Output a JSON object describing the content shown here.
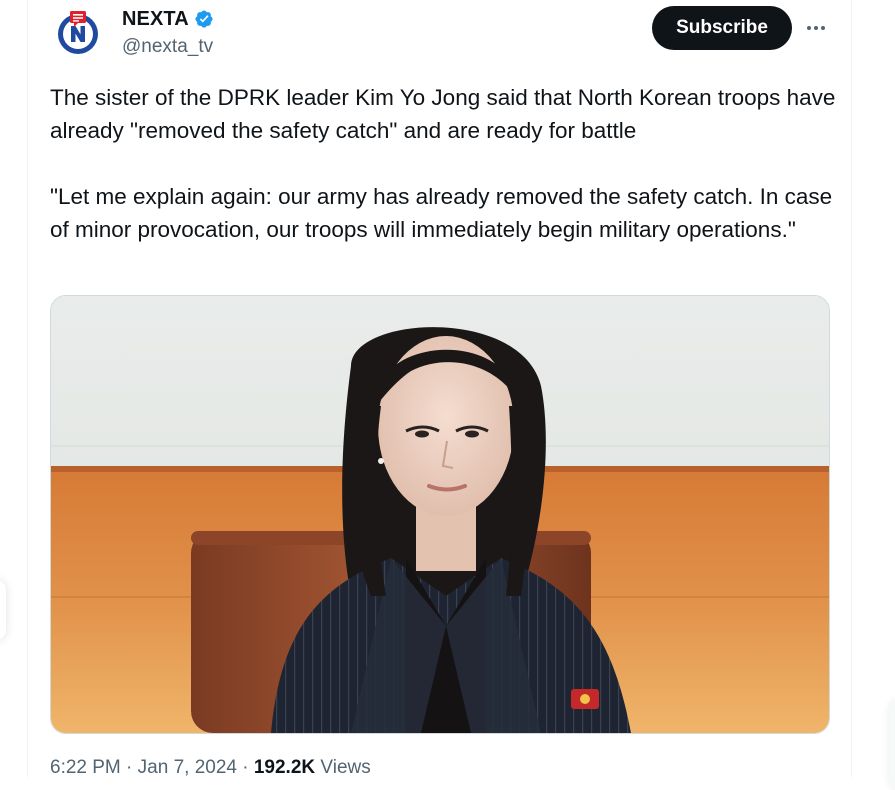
{
  "author": {
    "display_name": "NEXTA",
    "handle": "@nexta_tv",
    "verified": true,
    "avatar_letter": "N"
  },
  "actions": {
    "subscribe_label": "Subscribe",
    "more_icon": "more-horizontal-icon"
  },
  "tweet": {
    "paragraphs": [
      "The sister of the DPRK leader Kim Yo Jong said that North Korean troops have already \"removed the safety catch\" and are ready for battle",
      "\"Let me explain again: our army has already removed the safety catch. In case of minor provocation, our troops will immediately begin military operations.\""
    ]
  },
  "meta": {
    "time": "6:22 PM",
    "separator": "·",
    "date": "Jan 7, 2024",
    "views_count": "192.2K",
    "views_label": "Views"
  },
  "colors": {
    "accent": "#1d9bf0",
    "button_bg": "#0f1419",
    "secondary_text": "#536471",
    "nexta_red": "#e1202b",
    "nexta_blue": "#1f4aa0"
  }
}
